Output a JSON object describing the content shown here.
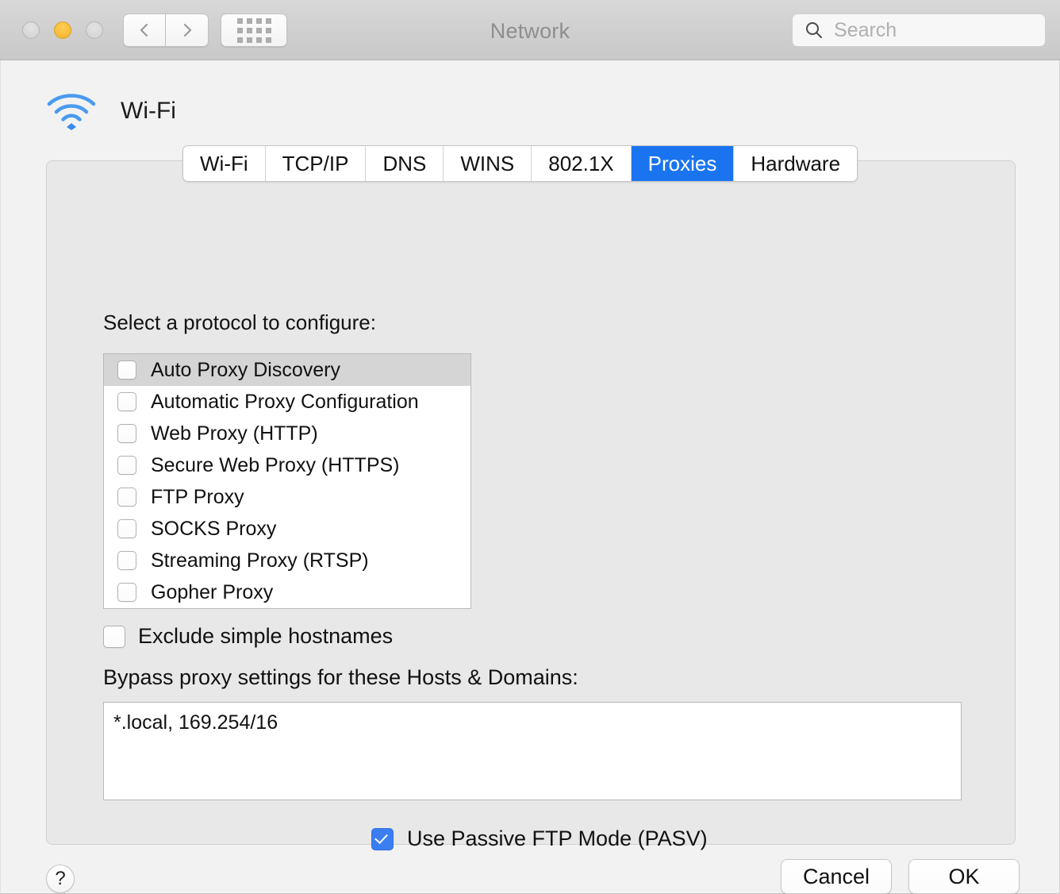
{
  "window": {
    "title": "Network",
    "traffic_lights": [
      {
        "name": "close",
        "state": "disabled",
        "color": "#d6d6d6"
      },
      {
        "name": "minimize",
        "state": "enabled",
        "color": "#f9bd3a"
      },
      {
        "name": "zoom",
        "state": "disabled",
        "color": "#d6d6d6"
      }
    ]
  },
  "toolbar": {
    "back_icon": "chevron-left-icon",
    "forward_icon": "chevron-right-icon",
    "grid_icon": "grid-dots-icon",
    "search": {
      "icon": "search-icon",
      "placeholder": "Search",
      "value": ""
    }
  },
  "interface": {
    "icon": "wifi-icon",
    "icon_color": "#4a9bf0",
    "name": "Wi-Fi"
  },
  "tabs": [
    {
      "label": "Wi-Fi",
      "selected": false
    },
    {
      "label": "TCP/IP",
      "selected": false
    },
    {
      "label": "DNS",
      "selected": false
    },
    {
      "label": "WINS",
      "selected": false
    },
    {
      "label": "802.1X",
      "selected": false
    },
    {
      "label": "Proxies",
      "selected": true
    },
    {
      "label": "Hardware",
      "selected": false
    }
  ],
  "accent_color": "#1a74f0",
  "panel": {
    "protocol_section_label": "Select a protocol to configure:",
    "protocols": [
      {
        "label": "Auto Proxy Discovery",
        "checked": false,
        "highlighted": true
      },
      {
        "label": "Automatic Proxy Configuration",
        "checked": false,
        "highlighted": false
      },
      {
        "label": "Web Proxy (HTTP)",
        "checked": false,
        "highlighted": false
      },
      {
        "label": "Secure Web Proxy (HTTPS)",
        "checked": false,
        "highlighted": false
      },
      {
        "label": "FTP Proxy",
        "checked": false,
        "highlighted": false
      },
      {
        "label": "SOCKS Proxy",
        "checked": false,
        "highlighted": false
      },
      {
        "label": "Streaming Proxy (RTSP)",
        "checked": false,
        "highlighted": false
      },
      {
        "label": "Gopher Proxy",
        "checked": false,
        "highlighted": false
      }
    ],
    "exclude_simple_hostnames": {
      "label": "Exclude simple hostnames",
      "checked": false
    },
    "bypass_label": "Bypass proxy settings for these Hosts & Domains:",
    "bypass_value": "*.local, 169.254/16",
    "passive_ftp": {
      "label": "Use Passive FTP Mode (PASV)",
      "checked": true
    }
  },
  "footer": {
    "help_label": "?",
    "cancel_label": "Cancel",
    "ok_label": "OK"
  }
}
